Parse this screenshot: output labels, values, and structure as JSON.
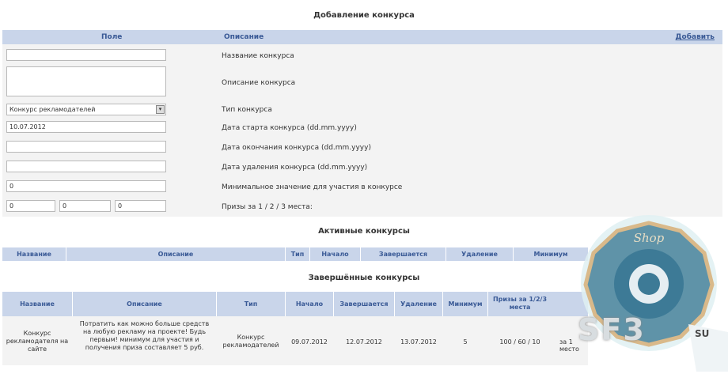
{
  "add_section": {
    "title": "Добавление конкурса",
    "header": {
      "field": "Поле",
      "description": "Описание",
      "add_link": "Добавить"
    },
    "rows": [
      {
        "input_value": "",
        "label": "Название конкурса"
      },
      {
        "input_value": "",
        "label": "Описание конкурса"
      },
      {
        "input_value": "Конкурс рекламодателей",
        "label": "Тип конкурса"
      },
      {
        "input_value": "10.07.2012",
        "label": "Дата старта конкурса (dd.mm.yyyy)"
      },
      {
        "input_value": "",
        "label": "Дата окончания конкурса (dd.mm.yyyy)"
      },
      {
        "input_value": "",
        "label": "Дата удаления конкурса (dd.mm.yyyy)"
      },
      {
        "input_value": "0",
        "label": "Минимальное значение для участия в конкурсе"
      },
      {
        "input_values": [
          "0",
          "0",
          "0"
        ],
        "label": "Призы за 1 / 2 / 3 места:"
      }
    ],
    "select_arrow": "▾"
  },
  "active_section": {
    "title": "Активные конкурсы",
    "columns": [
      "Название",
      "Описание",
      "Тип",
      "Начало",
      "Завершается",
      "Удаление",
      "Минимум"
    ]
  },
  "finished_section": {
    "title": "Завершённые конкурсы",
    "columns": [
      "Название",
      "Описание",
      "Тип",
      "Начало",
      "Завершается",
      "Удаление",
      "Минимум",
      "Призы за 1/2/3 места"
    ],
    "row": {
      "name": "Конкурс рекламодателя на сайте",
      "description": "Потратить как можно больше средств на любую рекламу на проекте! Будь первым! минимум для участия и получения приза составляет 5 руб.",
      "type": "Конкурс рекламодателей",
      "start": "09.07.2012",
      "end": "12.07.2012",
      "delete": "13.07.2012",
      "minimum": "5",
      "prizes": "100 / 60 / 10",
      "extra": "за 1 место"
    }
  },
  "watermark": {
    "shop_text": "Shop",
    "brand": "SF3",
    "suffix": "SU"
  },
  "colors": {
    "header_bg": "#c9d5ea",
    "header_text": "#3a5a96",
    "row_bg": "#f3f3f3"
  }
}
